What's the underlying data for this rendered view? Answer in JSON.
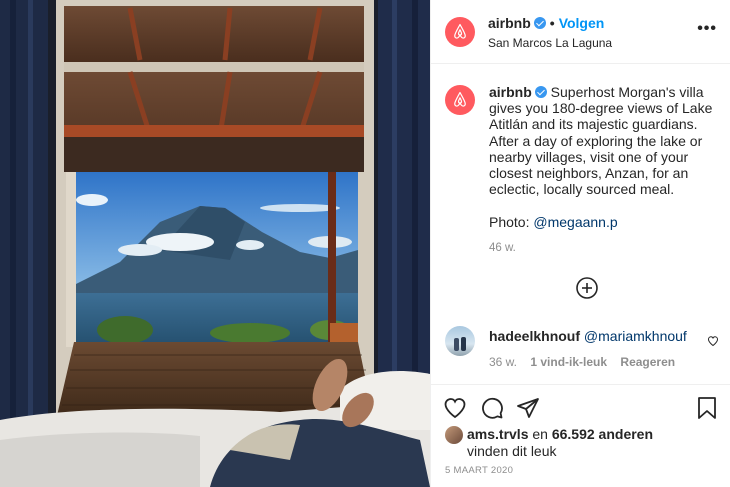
{
  "post": {
    "photo_alt_icon": "photo-lake-atitlan"
  },
  "header": {
    "username": "airbnb",
    "separator": "•",
    "follow_label": "Volgen",
    "location": "San Marcos La Laguna",
    "more_icon": "ellipsis-icon",
    "more_label": "•••"
  },
  "caption": {
    "username": "airbnb",
    "text": "Superhost Morgan's villa gives you 180-degree views of Lake Atitlán and its majestic guardians. After a day of exploring the lake or nearby villages, visit one of your closest neighbors, Anzan, for an eclectic, locally sourced meal.",
    "photo_prefix": "Photo: ",
    "photo_mention": "@megaann.p",
    "time": "46 w."
  },
  "comment": {
    "username": "hadeelkhnouf",
    "mention": "@mariamkhnouf",
    "time": "36 w.",
    "likes": "1 vind-ik-leuk",
    "reply": "Reageren"
  },
  "likes": {
    "users": "ams.trvls",
    "connector": " en ",
    "count": "66.592 anderen",
    "suffix": "vinden dit leuk"
  },
  "date": "5 MAART 2020",
  "colors": {
    "brand": "#ff5a5f",
    "link": "#0095f6",
    "verified": "#3897f0",
    "muted": "#8e8e8e"
  }
}
